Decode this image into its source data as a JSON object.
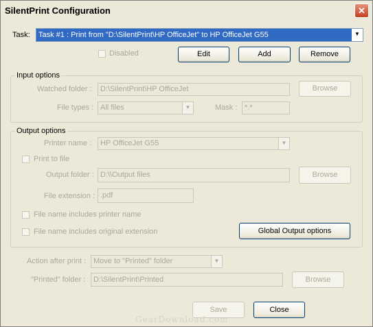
{
  "window": {
    "title": "SilentPrint Configuration",
    "close_symbol": "✕"
  },
  "task": {
    "label": "Task:",
    "value": "Task #1 : Print from \"D:\\SilentPrint\\HP OfficeJet\" to HP OfficeJet G55",
    "disabled_label": "Disabled",
    "edit_label": "Edit",
    "add_label": "Add",
    "remove_label": "Remove"
  },
  "input_options": {
    "title": "Input options",
    "watched_folder_label": "Watched folder :",
    "watched_folder_value": "D:\\SilentPrint\\HP OfficeJet",
    "browse_label": "Browse",
    "file_types_label": "File types :",
    "file_types_value": "All files",
    "mask_label": "Mask :",
    "mask_value": "*.*"
  },
  "output_options": {
    "title": "Output options",
    "printer_name_label": "Printer name :",
    "printer_name_value": "HP OfficeJet G55",
    "print_to_file_label": "Print to file",
    "output_folder_label": "Output folder :",
    "output_folder_value": "D:\\\\Output files",
    "browse_label": "Browse",
    "file_extension_label": "File extension :",
    "file_extension_value": ".pdf",
    "includes_printer_label": "File name includes printer name",
    "includes_extension_label": "File name includes original extension",
    "global_output_label": "Global Output options"
  },
  "after_print": {
    "action_label": "Action after print :",
    "action_value": "Move to \"Printed\" folder",
    "printed_folder_label": "\"Printed\" folder :",
    "printed_folder_value": "D:\\SilentPrint\\Printed",
    "browse_label": "Browse"
  },
  "footer": {
    "save_label": "Save",
    "close_label": "Close"
  },
  "watermark": "GearDownload.com",
  "colors": {
    "window_bg": "#ece9d8",
    "disabled_text": "#aca899",
    "button_border": "#003c74",
    "close_button": "#c4401f"
  }
}
